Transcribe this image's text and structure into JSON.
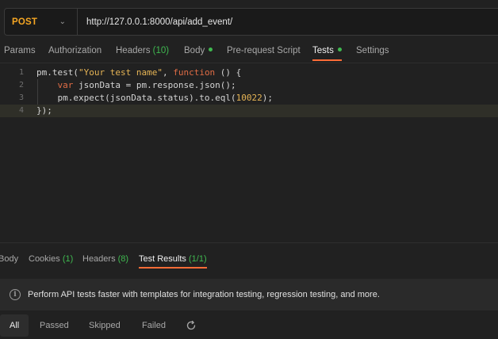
{
  "request": {
    "method": "POST",
    "url": "http://127.0.0.1:8000/api/add_event/"
  },
  "request_tabs": [
    {
      "label": "Params"
    },
    {
      "label": "Authorization"
    },
    {
      "label": "Headers",
      "count": "(10)"
    },
    {
      "label": "Body",
      "dot": true
    },
    {
      "label": "Pre-request Script"
    },
    {
      "label": "Tests",
      "dot": true,
      "active": true
    },
    {
      "label": "Settings"
    }
  ],
  "editor": {
    "line_numbers": [
      "1",
      "2",
      "3",
      "4"
    ],
    "lines": {
      "l1_a": "pm.test(",
      "l1_str": "\"Your test name\"",
      "l1_b": ", ",
      "l1_kw": "function",
      "l1_c": " () {",
      "l2_kw": "var",
      "l2_a": " jsonData = pm.response.json();",
      "l3_a": "pm.expect(jsonData.status).to.eql(",
      "l3_num": "10022",
      "l3_b": ");",
      "l4_a": "});"
    }
  },
  "response_tabs": [
    {
      "label": "Body"
    },
    {
      "label": "Cookies",
      "count": "(1)"
    },
    {
      "label": "Headers",
      "count": "(8)"
    },
    {
      "label": "Test Results",
      "count": "(1/1)",
      "active": true
    }
  ],
  "banner": {
    "icon": "info-icon",
    "text": "Perform API tests faster with templates for integration testing, regression testing, and more."
  },
  "filters": [
    {
      "label": "All",
      "active": true
    },
    {
      "label": "Passed"
    },
    {
      "label": "Skipped"
    },
    {
      "label": "Failed"
    }
  ],
  "refresh_icon": "refresh-icon",
  "colors": {
    "accent": "#ff6c37",
    "success": "#3fb950",
    "method": "#f5a623"
  }
}
